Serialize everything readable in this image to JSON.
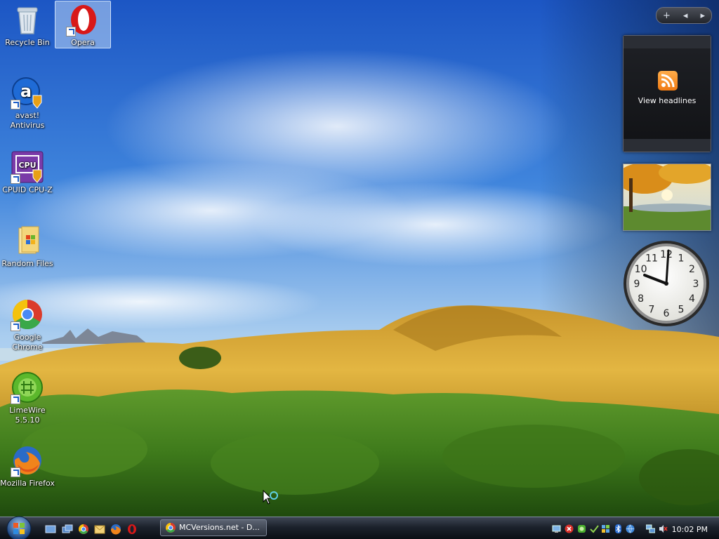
{
  "desktop": {
    "icons": [
      {
        "label": "Recycle Bin",
        "icon": "recycle-bin-icon"
      },
      {
        "label": "Opera",
        "icon": "opera-icon"
      },
      {
        "label": "avast! Antivirus",
        "icon": "avast-icon"
      },
      {
        "label": "CPUID CPU-Z",
        "icon": "cpuz-icon"
      },
      {
        "label": "Random Files",
        "icon": "folder-icon"
      },
      {
        "label": "Google Chrome",
        "icon": "chrome-icon"
      },
      {
        "label": "LimeWire 5.5.10",
        "icon": "limewire-icon"
      },
      {
        "label": "Mozilla Firefox",
        "icon": "firefox-icon"
      }
    ]
  },
  "sidebar": {
    "controls": {
      "add": "+",
      "prev": "◂",
      "next": "▸"
    },
    "feed_gadget": {
      "label": "View headlines"
    },
    "clock": {
      "numbers": [
        "12",
        "1",
        "2",
        "3",
        "4",
        "5",
        "6",
        "7",
        "8",
        "9",
        "10",
        "11"
      ]
    }
  },
  "taskbar": {
    "task_button_label": "MCVersions.net - D...",
    "clock": "10:02 PM"
  },
  "colors": {
    "taskbar": "#1c222c",
    "accent": "#3d78d0"
  }
}
